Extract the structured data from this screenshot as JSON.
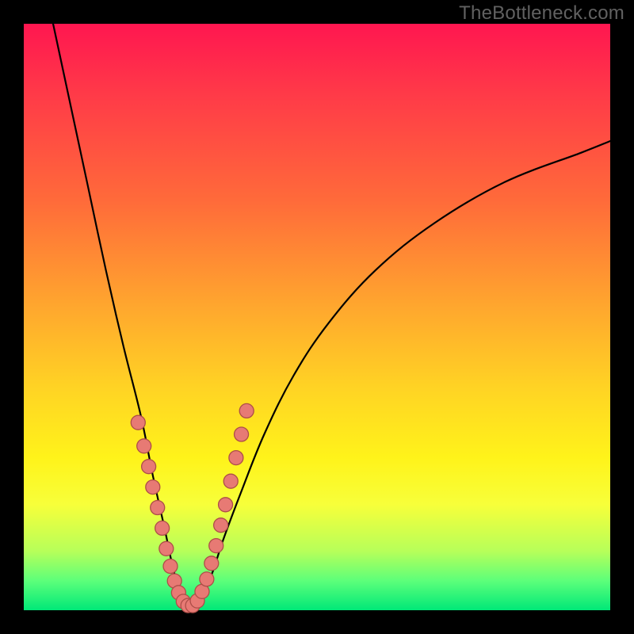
{
  "watermark": "TheBottleneck.com",
  "colors": {
    "frame": "#000000",
    "gradient_stops": [
      "#ff1650",
      "#ff3a48",
      "#ff6a3a",
      "#ffa62e",
      "#ffd324",
      "#fff31a",
      "#f7ff3a",
      "#b6ff5a",
      "#5cff7a",
      "#00e878"
    ],
    "curve": "#000000",
    "dot_fill": "#e77a74",
    "dot_stroke": "#ad4e48"
  },
  "chart_data": {
    "type": "line",
    "title": "",
    "xlabel": "",
    "ylabel": "",
    "xlim": [
      0,
      100
    ],
    "ylim": [
      0,
      100
    ],
    "note": "No numeric axes are shown; x/y are normalized 0–100 across the colored panel. y is bottleneck % (0 at bottom/green, 100 at top/red). Curve is a V-shaped bottleneck profile with minimum ≈ x 28.",
    "series": [
      {
        "name": "bottleneck-curve",
        "x": [
          5,
          8,
          11,
          14,
          17,
          20,
          22,
          24,
          25.5,
          27,
          28.5,
          30,
          32,
          34,
          37,
          41,
          46,
          52,
          60,
          70,
          82,
          95,
          100
        ],
        "y": [
          100,
          86,
          72,
          58,
          45,
          33,
          23,
          14,
          7,
          2,
          0.5,
          2,
          6,
          12,
          20,
          30,
          40,
          49,
          58,
          66,
          73,
          78,
          80
        ]
      }
    ],
    "markers": {
      "name": "highlight-dots",
      "note": "Salmon dots clustered near the valley on both branches and along the floor.",
      "x": [
        19.5,
        20.5,
        21.3,
        22.0,
        22.8,
        23.6,
        24.3,
        25.0,
        25.7,
        26.4,
        27.2,
        28.0,
        28.8,
        29.6,
        30.4,
        31.2,
        32.0,
        32.8,
        33.6,
        34.4,
        35.3,
        36.2,
        37.1,
        38.0
      ],
      "y": [
        32,
        28,
        24.5,
        21,
        17.5,
        14,
        10.5,
        7.5,
        5,
        3,
        1.5,
        0.8,
        0.8,
        1.6,
        3.2,
        5.3,
        8,
        11,
        14.5,
        18,
        22,
        26,
        30,
        34
      ]
    }
  }
}
